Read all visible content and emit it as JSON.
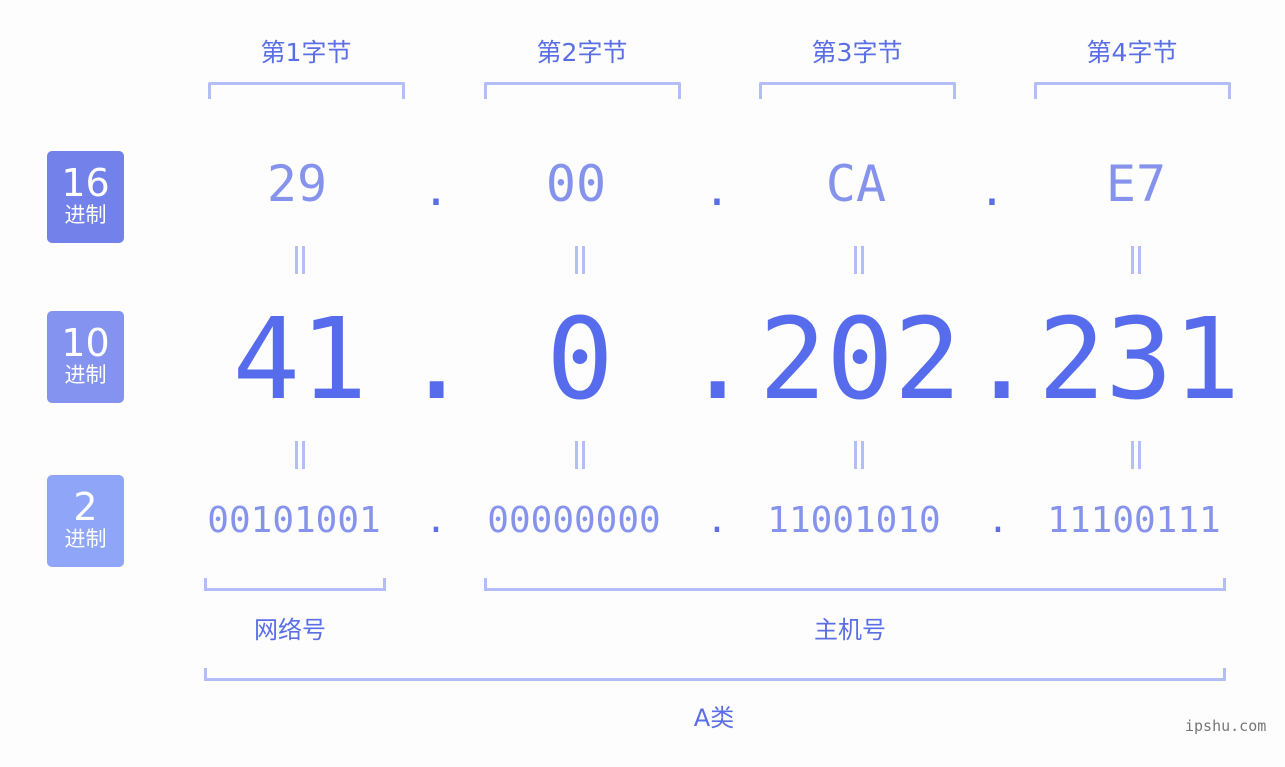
{
  "byte_headers": [
    "第1字节",
    "第2字节",
    "第3字节",
    "第4字节"
  ],
  "rows": {
    "hex": {
      "badge_number": "16",
      "badge_label": "进制",
      "badge_color": "#7381ea",
      "values": [
        "29",
        "00",
        "CA",
        "E7"
      ]
    },
    "dec": {
      "badge_number": "10",
      "badge_label": "进制",
      "badge_color": "#8593f0",
      "values": [
        "41",
        "0",
        "202",
        "231"
      ]
    },
    "bin": {
      "badge_number": "2",
      "badge_label": "进制",
      "badge_color": "#8ea5f8",
      "values": [
        "00101001",
        "00000000",
        "11001010",
        "11100111"
      ]
    }
  },
  "separator": ".",
  "equals_sign": "=",
  "network_label": "网络号",
  "host_label": "主机号",
  "class_label": "A类",
  "site": "ipshu.com",
  "colors": {
    "accent": "#566cec",
    "light": "#8593ec",
    "bracket": "#b3bdf6"
  }
}
